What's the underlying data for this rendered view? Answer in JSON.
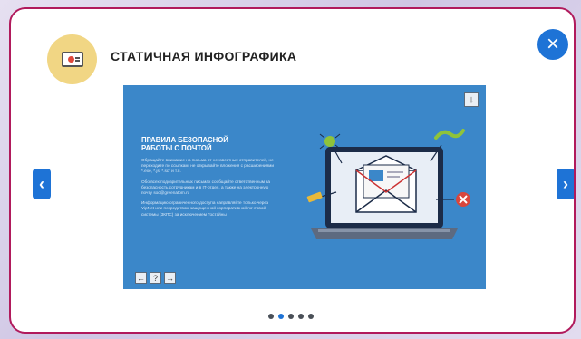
{
  "header": {
    "title": "СТАТИЧНАЯ ИНФОГРАФИКА",
    "icon": "presentation-screen-icon",
    "close_icon": "×"
  },
  "navigation": {
    "prev_icon": "‹",
    "next_icon": "›"
  },
  "slide": {
    "download_icon": "↓",
    "title": "ПРАВИЛА БЕЗОПАСНОЙ РАБОТЫ С ПОЧТОЙ",
    "paragraphs": [
      "Обращайте внимание на письма от неизвестных отправителей, не переходите по ссылкам, не открывайте вложения с расширениями *.exe, *.js, *.scr и т.п.",
      "Обо всех подозрительных письмах сообщайте ответственным за безопасность сотрудникам и в IT-отдел, а также на электронную почту soc@greenatom.ru",
      "Информацию ограниченного доступа направляйте только через VipNet или посредством защищенной корпоративной почтовой системы (ЗКПС) за исключением Гостайны"
    ],
    "controls": {
      "prev": "←",
      "help": "?",
      "next": "→"
    }
  },
  "pagination": {
    "count": 5,
    "active": 1
  },
  "colors": {
    "accent": "#1e73d6",
    "border": "#b11a5c",
    "slide_bg": "#3b87c9",
    "icon_bg": "#f1d684"
  }
}
